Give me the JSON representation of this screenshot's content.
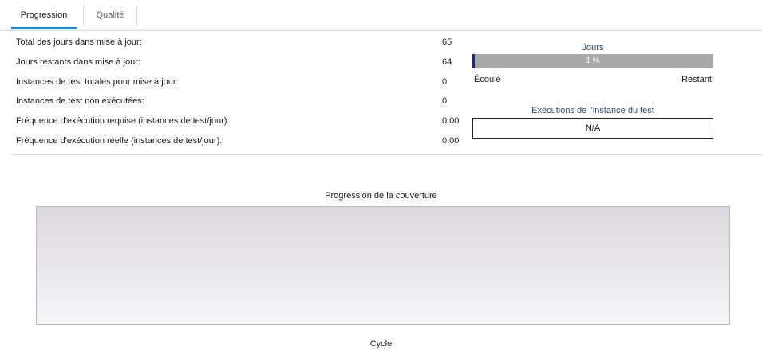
{
  "tabs": [
    {
      "label": "Progression",
      "active": true
    },
    {
      "label": "Qualité",
      "active": false
    }
  ],
  "stats": [
    {
      "label": "Total des jours dans mise à jour:",
      "value": "65"
    },
    {
      "label": "Jours restants dans mise à jour:",
      "value": "64"
    },
    {
      "label": "Instances de test totales pour mise à jour:",
      "value": "0"
    },
    {
      "label": "Instances de test non exécutées:",
      "value": "0"
    },
    {
      "label": "Fréquence d'exécution requise (instances de test/jour):",
      "value": "0,00"
    },
    {
      "label": "Fréquence d'exécution réelle (instances de test/jour):",
      "value": "0,00"
    }
  ],
  "days_gauge": {
    "title": "Jours",
    "percent_text": "1 %",
    "elapsed_fraction": 0.01,
    "left_label": "Écoulé",
    "right_label": "Restant"
  },
  "executions_gauge": {
    "title": "Exécutions de l'instance du test",
    "value": "N/A"
  },
  "coverage_chart": {
    "title": "Progression de la couverture",
    "xlabel": "Cycle"
  },
  "colors": {
    "accent_tab": "#1a8ad4",
    "progress_fill": "#1c2d78",
    "progress_track": "#a9a9a9",
    "gauge_title": "#2b4a7a"
  }
}
